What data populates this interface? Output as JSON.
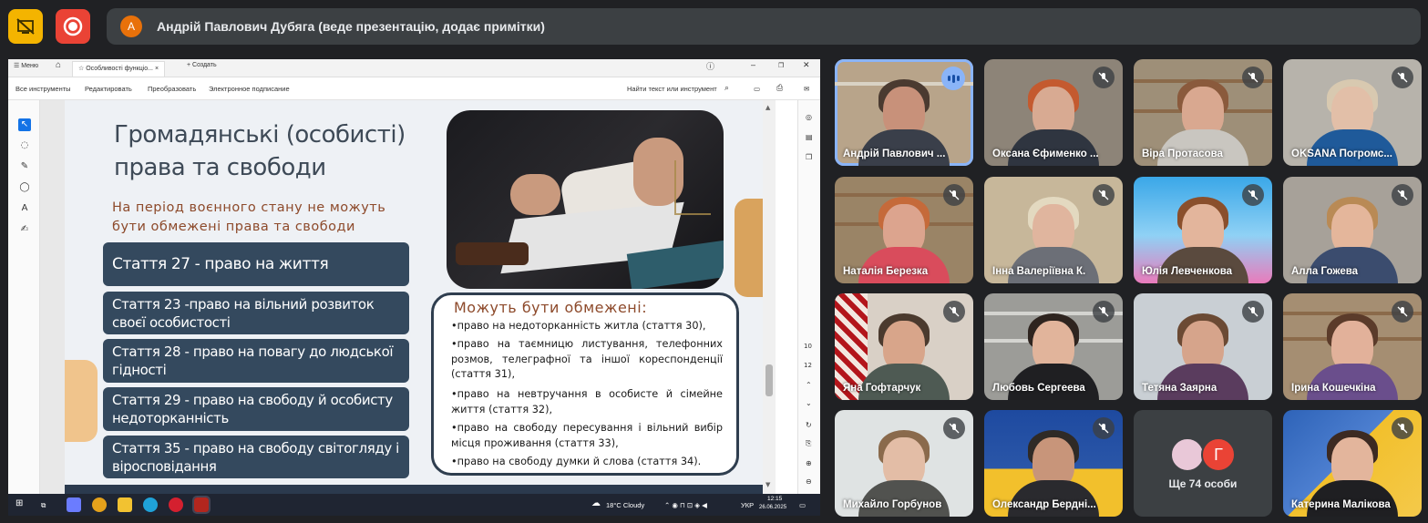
{
  "meet": {
    "presenter_initial": "А",
    "banner_text": "Андрій Павлович Дубяга (веде презентацію, додає примітки)",
    "more": {
      "initial": "Г",
      "label": "Ще 74 особи"
    },
    "participants": [
      "Андрій Павлович ...",
      "Оксана Єфименко ...",
      "Віра Протасова",
      "OKSANA Погромс...",
      "Наталія Березка",
      "Інна Валеріївна К.",
      "Юлія Левченкова",
      "Алла Гожева",
      "Яна Гофтарчук",
      "Любовь Сергеева",
      "Тетяна Заярна",
      "Ірина Кошечкіна",
      "Михайло Горбунов",
      "Олександр Бердні...",
      "Катерина Малікова"
    ],
    "colors": {
      "background": "#202124",
      "banner": "#3c4043",
      "speaking": "#8ab4f8",
      "presenter_avatar": "#e8710a"
    }
  },
  "pdf_viewer": {
    "menu": "Меню",
    "tab_title": "Особливості функціо...",
    "new_tab": "Создать",
    "toolbar": [
      "Все инструменты",
      "Редактировать",
      "Преобразовать",
      "Электронное подписание"
    ],
    "search_placeholder": "Найти текст или инструмент",
    "page_numbers": [
      "10",
      "12"
    ]
  },
  "slide": {
    "title_line1": "Громадянські (особисті)",
    "title_line2": "права та свободи",
    "subtitle_line1": "На період воєнного стану не можуть",
    "subtitle_line2": "бути обмежені права та свободи",
    "articles": [
      "Стаття 27 - право на життя",
      "Стаття 23 -право на вільний розвиток своєї особистості",
      "Стаття 28 - право на повагу до людської гідності",
      "Стаття 29 - право на свободу й особисту недоторканність",
      "Стаття 35 - право на свободу світогляду і віросповідання"
    ],
    "restrict_title": "Можуть бути обмежені:",
    "restrict_items": [
      "•право на недоторканність житла (стаття 30),",
      "•право на таємницю листування, телефонних розмов, телеграфної та іншої кореспонденції (стаття 31),",
      "•право на невтручання в особисте й сімейне життя (стаття 32),",
      "•право на свободу пересування і вільний вибір місця проживання (стаття 33),",
      "•право на свободу думки й слова (стаття 34)."
    ]
  },
  "taskbar": {
    "weather": "18°C Cloudy",
    "lang": "УКР",
    "time": "12:15",
    "date": "26.06.2025"
  }
}
